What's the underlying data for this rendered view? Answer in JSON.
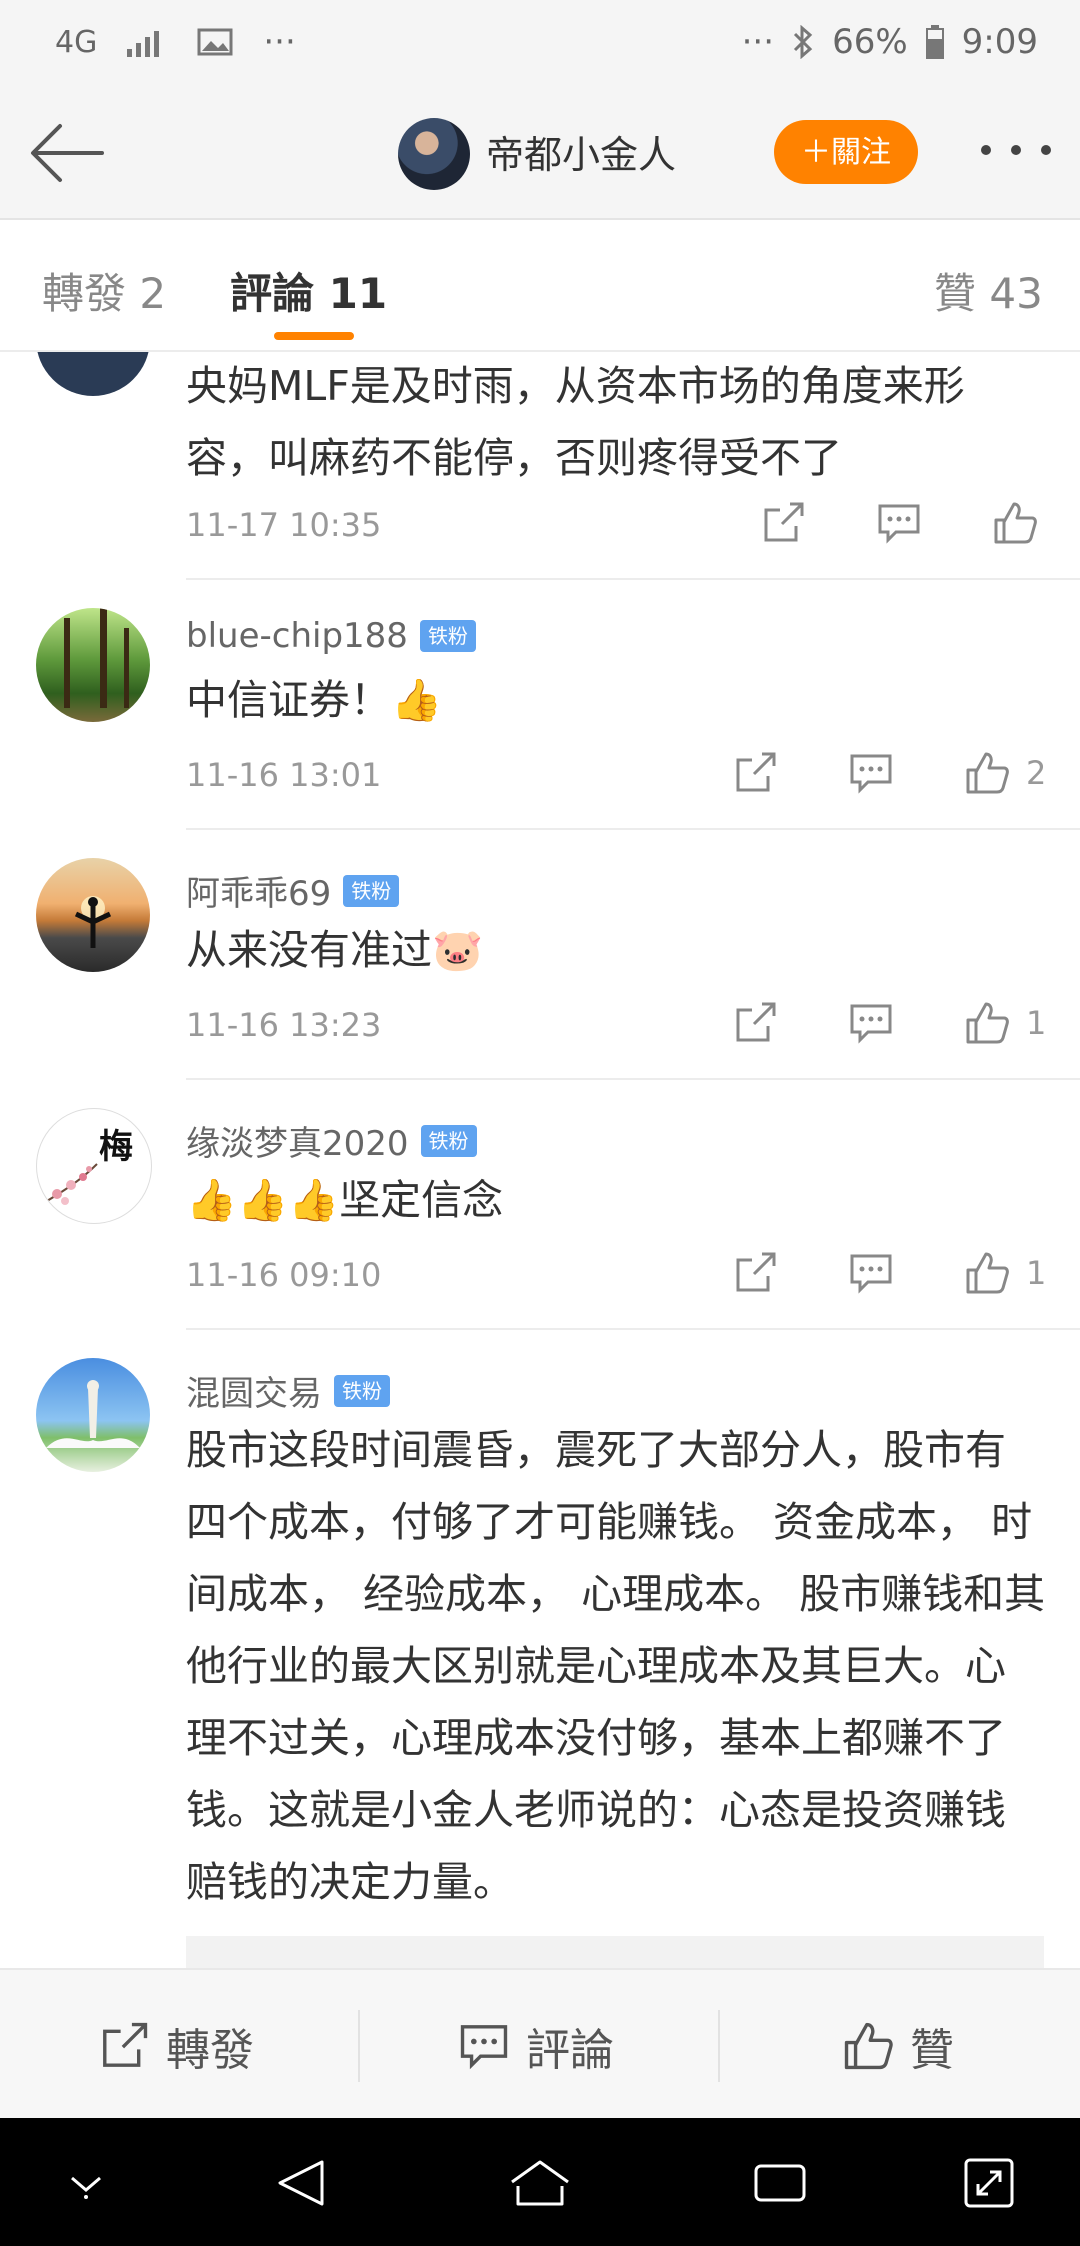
{
  "status": {
    "network": "4G",
    "battery": "66%",
    "time": "9:09",
    "dots": "···"
  },
  "header": {
    "title": "帝都小金人",
    "follow_label": "＋關注"
  },
  "tabs": [
    {
      "label": "轉發 2"
    },
    {
      "label": "評論 11"
    },
    {
      "label": "贊 43"
    }
  ],
  "comments": [
    {
      "user": "",
      "badge": "",
      "text": "央妈MLF是及时雨，从资本市场的角度来形容，叫麻药不能停，否则疼得受不了",
      "time": "11-17 10:35",
      "likes": ""
    },
    {
      "user": "blue-chip188",
      "badge": "铁粉",
      "text": "中信证券！👍",
      "time": "11-16 13:01",
      "likes": "2"
    },
    {
      "user": "阿乖乖69",
      "badge": "铁粉",
      "text": "从来没有准过🐷",
      "time": "11-16 13:23",
      "likes": "1"
    },
    {
      "user": "缘淡梦真2020",
      "badge": "铁粉",
      "text": "👍👍👍坚定信念",
      "time": "11-16 09:10",
      "likes": "1"
    },
    {
      "user": "混圆交易",
      "badge": "铁粉",
      "text": "股市这段时间震昏，震死了大部分人，股市有四个成本，付够了才可能赚钱。 资金成本， 时间成本， 经验成本， 心理成本。 股市赚钱和其他行业的最大区别就是心理成本及其巨大。心理不过关，心理成本没付够，基本上都赚不了钱。这就是小金人老师说的：心态是投资赚钱赔钱的决定力量。",
      "time": "",
      "likes": ""
    }
  ],
  "avatar_text": {
    "plum": "梅"
  },
  "bottom": {
    "repost": "轉發",
    "comment": "評論",
    "like": "贊"
  },
  "colors": {
    "accent": "#ff8200",
    "badge": "#5fa3f0"
  }
}
